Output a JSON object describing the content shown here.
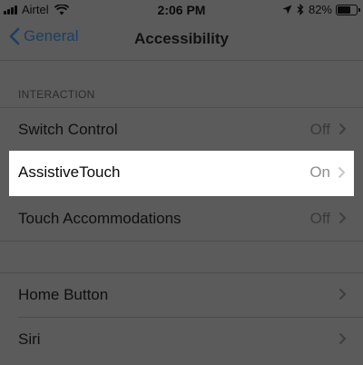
{
  "status_bar": {
    "carrier": "Airtel",
    "time": "2:06 PM",
    "battery": "82%",
    "battery_level": 0.82,
    "icons": [
      "signal-icon",
      "wifi-icon",
      "location-icon",
      "bluetooth-icon",
      "battery-icon"
    ]
  },
  "nav": {
    "back_label": "General",
    "title": "Accessibility",
    "accent": "#1d3e63"
  },
  "section": {
    "header": "INTERACTION"
  },
  "rows": [
    {
      "label": "Switch Control",
      "value": "Off"
    },
    {
      "label": "AssistiveTouch",
      "value": "On",
      "highlighted": true
    },
    {
      "label": "Touch Accommodations",
      "value": "Off"
    },
    {
      "label": "Home Button",
      "value": ""
    },
    {
      "label": "Siri",
      "value": ""
    }
  ]
}
